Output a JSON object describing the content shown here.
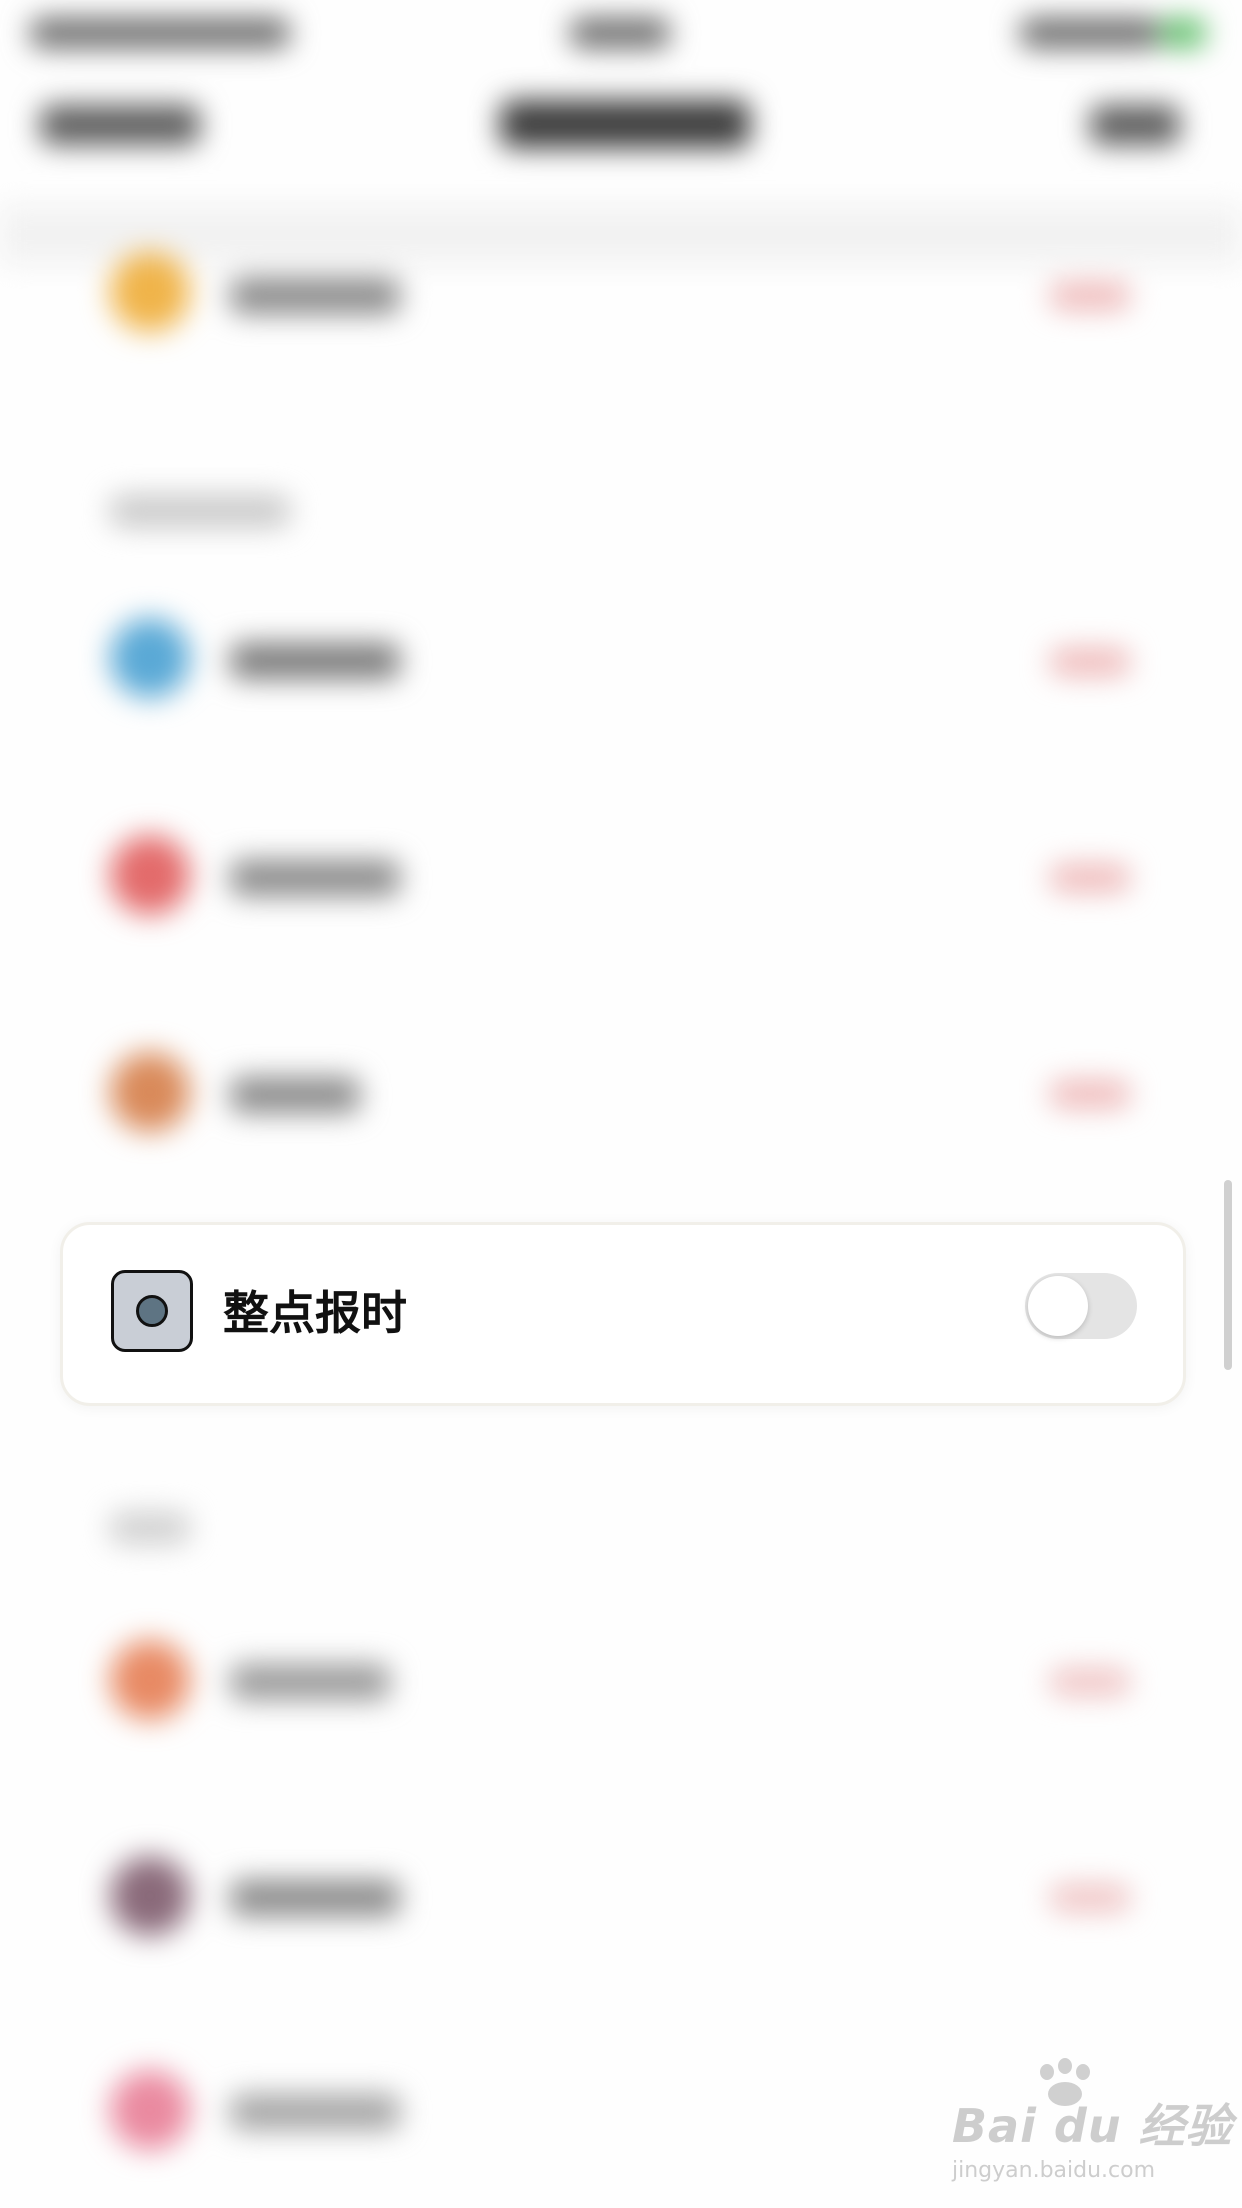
{
  "card": {
    "label": "整点报时",
    "toggle_on": false
  },
  "watermark": {
    "brand": "Bai du 经验",
    "url": "jingyan.baidu.com"
  },
  "colors": {
    "background": "#fefefe",
    "card_background": "#ffffff",
    "toggle_off": "#e4e4e4",
    "icon_fill": "#c9ced6",
    "icon_dot": "#5e7483"
  }
}
